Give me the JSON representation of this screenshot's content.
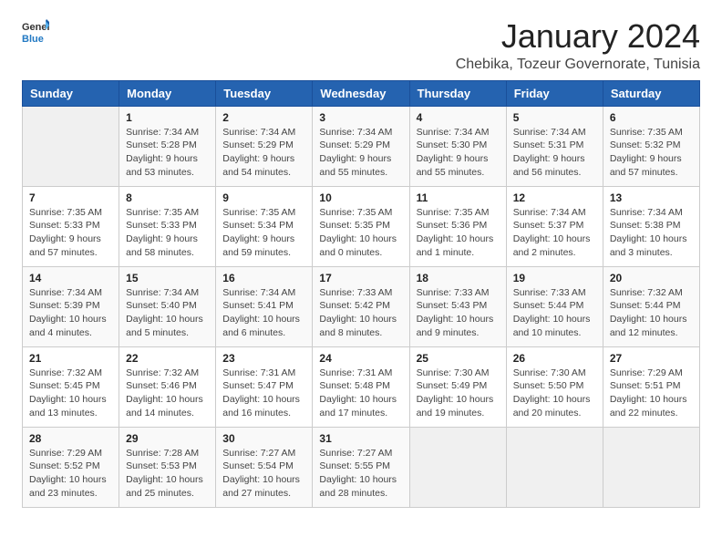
{
  "header": {
    "logo": {
      "general": "General",
      "blue": "Blue"
    },
    "title": "January 2024",
    "location": "Chebika, Tozeur Governorate, Tunisia"
  },
  "calendar": {
    "weekdays": [
      "Sunday",
      "Monday",
      "Tuesday",
      "Wednesday",
      "Thursday",
      "Friday",
      "Saturday"
    ],
    "weeks": [
      [
        {
          "day": null
        },
        {
          "day": "1",
          "sunrise": "7:34 AM",
          "sunset": "5:28 PM",
          "daylight": "9 hours and 53 minutes."
        },
        {
          "day": "2",
          "sunrise": "7:34 AM",
          "sunset": "5:29 PM",
          "daylight": "9 hours and 54 minutes."
        },
        {
          "day": "3",
          "sunrise": "7:34 AM",
          "sunset": "5:29 PM",
          "daylight": "9 hours and 55 minutes."
        },
        {
          "day": "4",
          "sunrise": "7:34 AM",
          "sunset": "5:30 PM",
          "daylight": "9 hours and 55 minutes."
        },
        {
          "day": "5",
          "sunrise": "7:34 AM",
          "sunset": "5:31 PM",
          "daylight": "9 hours and 56 minutes."
        },
        {
          "day": "6",
          "sunrise": "7:35 AM",
          "sunset": "5:32 PM",
          "daylight": "9 hours and 57 minutes."
        }
      ],
      [
        {
          "day": "7",
          "sunrise": "7:35 AM",
          "sunset": "5:33 PM",
          "daylight": "9 hours and 57 minutes."
        },
        {
          "day": "8",
          "sunrise": "7:35 AM",
          "sunset": "5:33 PM",
          "daylight": "9 hours and 58 minutes."
        },
        {
          "day": "9",
          "sunrise": "7:35 AM",
          "sunset": "5:34 PM",
          "daylight": "9 hours and 59 minutes."
        },
        {
          "day": "10",
          "sunrise": "7:35 AM",
          "sunset": "5:35 PM",
          "daylight": "10 hours and 0 minutes."
        },
        {
          "day": "11",
          "sunrise": "7:35 AM",
          "sunset": "5:36 PM",
          "daylight": "10 hours and 1 minute."
        },
        {
          "day": "12",
          "sunrise": "7:34 AM",
          "sunset": "5:37 PM",
          "daylight": "10 hours and 2 minutes."
        },
        {
          "day": "13",
          "sunrise": "7:34 AM",
          "sunset": "5:38 PM",
          "daylight": "10 hours and 3 minutes."
        }
      ],
      [
        {
          "day": "14",
          "sunrise": "7:34 AM",
          "sunset": "5:39 PM",
          "daylight": "10 hours and 4 minutes."
        },
        {
          "day": "15",
          "sunrise": "7:34 AM",
          "sunset": "5:40 PM",
          "daylight": "10 hours and 5 minutes."
        },
        {
          "day": "16",
          "sunrise": "7:34 AM",
          "sunset": "5:41 PM",
          "daylight": "10 hours and 6 minutes."
        },
        {
          "day": "17",
          "sunrise": "7:33 AM",
          "sunset": "5:42 PM",
          "daylight": "10 hours and 8 minutes."
        },
        {
          "day": "18",
          "sunrise": "7:33 AM",
          "sunset": "5:43 PM",
          "daylight": "10 hours and 9 minutes."
        },
        {
          "day": "19",
          "sunrise": "7:33 AM",
          "sunset": "5:44 PM",
          "daylight": "10 hours and 10 minutes."
        },
        {
          "day": "20",
          "sunrise": "7:32 AM",
          "sunset": "5:44 PM",
          "daylight": "10 hours and 12 minutes."
        }
      ],
      [
        {
          "day": "21",
          "sunrise": "7:32 AM",
          "sunset": "5:45 PM",
          "daylight": "10 hours and 13 minutes."
        },
        {
          "day": "22",
          "sunrise": "7:32 AM",
          "sunset": "5:46 PM",
          "daylight": "10 hours and 14 minutes."
        },
        {
          "day": "23",
          "sunrise": "7:31 AM",
          "sunset": "5:47 PM",
          "daylight": "10 hours and 16 minutes."
        },
        {
          "day": "24",
          "sunrise": "7:31 AM",
          "sunset": "5:48 PM",
          "daylight": "10 hours and 17 minutes."
        },
        {
          "day": "25",
          "sunrise": "7:30 AM",
          "sunset": "5:49 PM",
          "daylight": "10 hours and 19 minutes."
        },
        {
          "day": "26",
          "sunrise": "7:30 AM",
          "sunset": "5:50 PM",
          "daylight": "10 hours and 20 minutes."
        },
        {
          "day": "27",
          "sunrise": "7:29 AM",
          "sunset": "5:51 PM",
          "daylight": "10 hours and 22 minutes."
        }
      ],
      [
        {
          "day": "28",
          "sunrise": "7:29 AM",
          "sunset": "5:52 PM",
          "daylight": "10 hours and 23 minutes."
        },
        {
          "day": "29",
          "sunrise": "7:28 AM",
          "sunset": "5:53 PM",
          "daylight": "10 hours and 25 minutes."
        },
        {
          "day": "30",
          "sunrise": "7:27 AM",
          "sunset": "5:54 PM",
          "daylight": "10 hours and 27 minutes."
        },
        {
          "day": "31",
          "sunrise": "7:27 AM",
          "sunset": "5:55 PM",
          "daylight": "10 hours and 28 minutes."
        },
        {
          "day": null
        },
        {
          "day": null
        },
        {
          "day": null
        }
      ]
    ]
  },
  "labels": {
    "sunrise_prefix": "Sunrise: ",
    "sunset_prefix": "Sunset: ",
    "daylight_prefix": "Daylight: "
  }
}
